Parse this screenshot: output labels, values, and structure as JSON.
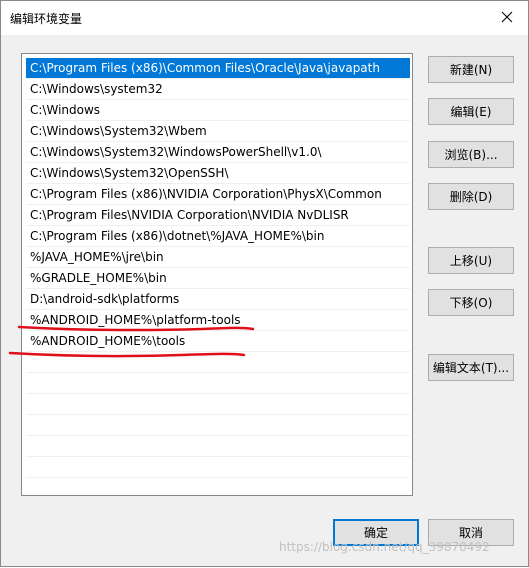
{
  "window": {
    "title": "编辑环境变量",
    "close_icon": "close-icon"
  },
  "path_list": {
    "items": [
      {
        "text": "C:\\Program Files (x86)\\Common Files\\Oracle\\Java\\javapath",
        "selected": true
      },
      {
        "text": "C:\\Windows\\system32",
        "selected": false
      },
      {
        "text": "C:\\Windows",
        "selected": false
      },
      {
        "text": "C:\\Windows\\System32\\Wbem",
        "selected": false
      },
      {
        "text": "C:\\Windows\\System32\\WindowsPowerShell\\v1.0\\",
        "selected": false
      },
      {
        "text": "C:\\Windows\\System32\\OpenSSH\\",
        "selected": false
      },
      {
        "text": "C:\\Program Files (x86)\\NVIDIA Corporation\\PhysX\\Common",
        "selected": false
      },
      {
        "text": "C:\\Program Files\\NVIDIA Corporation\\NVIDIA NvDLISR",
        "selected": false
      },
      {
        "text": "C:\\Program Files (x86)\\dotnet\\%JAVA_HOME%\\bin",
        "selected": false
      },
      {
        "text": "%JAVA_HOME%\\jre\\bin",
        "selected": false
      },
      {
        "text": "%GRADLE_HOME%\\bin",
        "selected": false
      },
      {
        "text": "D:\\android-sdk\\platforms",
        "selected": false
      },
      {
        "text": "%ANDROID_HOME%\\platform-tools",
        "selected": false
      },
      {
        "text": "%ANDROID_HOME%\\tools",
        "selected": false
      }
    ],
    "empty_rows": 7
  },
  "buttons": {
    "new": "新建(N)",
    "edit": "编辑(E)",
    "browse": "浏览(B)...",
    "delete": "删除(D)",
    "move_up": "上移(U)",
    "move_down": "下移(O)",
    "edit_text": "编辑文本(T)...",
    "ok": "确定",
    "cancel": "取消"
  },
  "annotation": {
    "stroke_color": "#e0101a",
    "underlined_items": [
      "%ANDROID_HOME%\\platform-tools",
      "%ANDROID_HOME%\\tools"
    ]
  },
  "watermark": {
    "text": "https://blog.csdn.net/qq_39870492"
  },
  "colors": {
    "selection": "#0078d7",
    "primary_border": "#0078d7",
    "dialog_bg": "#f0f0f0"
  }
}
